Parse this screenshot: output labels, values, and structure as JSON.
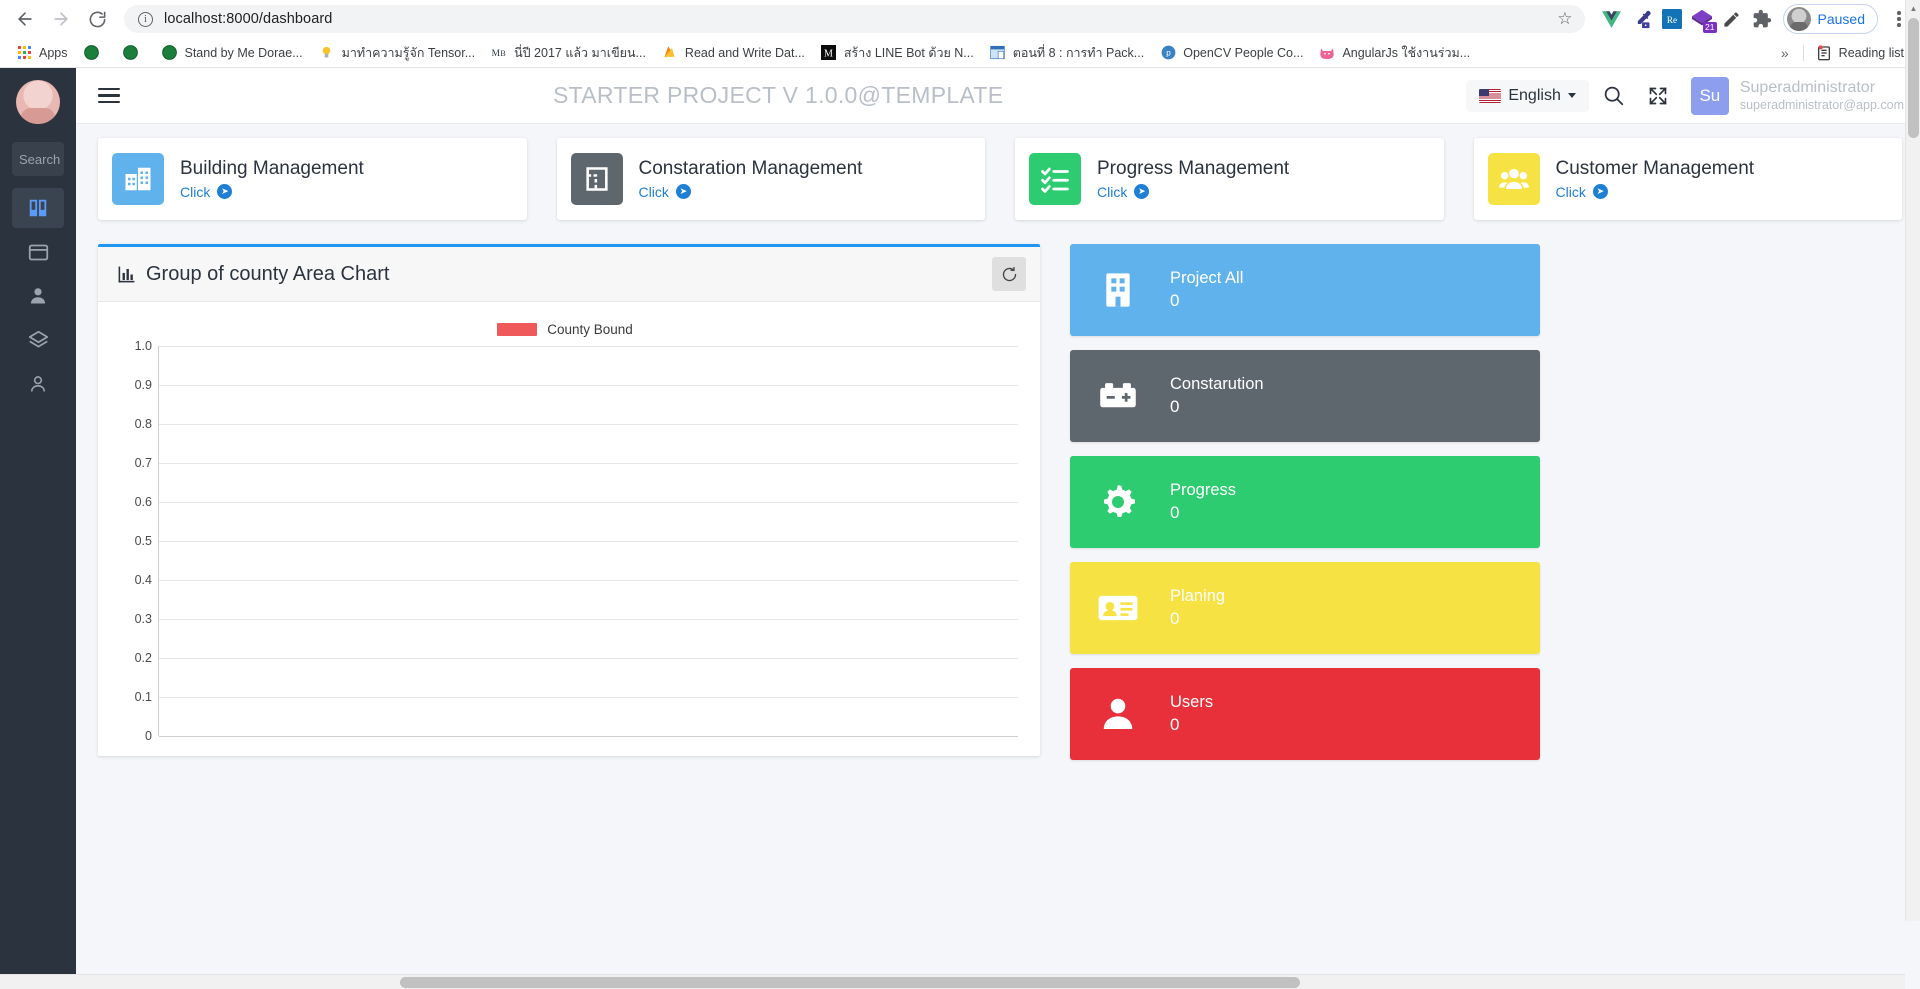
{
  "browser": {
    "back_label": "Back",
    "forward_label": "Forward",
    "reload_label": "Reload",
    "url": "localhost:8000/dashboard",
    "bookmark_star": "star-outline",
    "extensions": [
      {
        "name": "vue-devtools-icon",
        "label": "V"
      },
      {
        "name": "eyedropper-icon",
        "label": ""
      },
      {
        "name": "redux-devtools-icon",
        "label": "Re"
      },
      {
        "name": "badge-extension-icon",
        "label": "21"
      },
      {
        "name": "pencil-extension-icon",
        "label": ""
      },
      {
        "name": "puzzle-extensions-icon",
        "label": ""
      }
    ],
    "profile": {
      "label": "Paused"
    },
    "bookmarks": [
      {
        "label": "Apps",
        "icon": "apps-grid-icon"
      },
      {
        "label": "",
        "icon": "globe-icon"
      },
      {
        "label": "",
        "icon": "globe-icon"
      },
      {
        "label": "Stand by Me Dorae...",
        "icon": "globe-icon"
      },
      {
        "label": "มาทำความรู้จัก Tensor...",
        "icon": "bulb-icon"
      },
      {
        "label": "นี่ปี 2017 แล้ว มาเขียน...",
        "icon": "medium-icon"
      },
      {
        "label": "Read and Write Dat...",
        "icon": "firebase-icon"
      },
      {
        "label": "สร้าง LINE Bot ด้วย N...",
        "icon": "medium-square-icon"
      },
      {
        "label": "ตอนที่ 8 : การทำ Pack...",
        "icon": "window-icon"
      },
      {
        "label": "OpenCV People Co...",
        "icon": "python-icon"
      },
      {
        "label": "AngularJs ใช้งานร่วม...",
        "icon": "cat-icon"
      }
    ],
    "overflow_label": "»",
    "reading_list": "Reading list"
  },
  "sidebar": {
    "avatar": "user-avatar",
    "search_placeholder": "Search",
    "items": [
      {
        "name": "sidebar-item-dashboard",
        "icon": "book-icon",
        "active": true
      },
      {
        "name": "sidebar-item-window",
        "icon": "window-icon",
        "active": false
      },
      {
        "name": "sidebar-item-user",
        "icon": "person-icon",
        "active": false
      },
      {
        "name": "sidebar-item-layers",
        "icon": "layers-icon",
        "active": false
      },
      {
        "name": "sidebar-item-account",
        "icon": "person-outline-icon",
        "active": false
      }
    ]
  },
  "topbar": {
    "menu_icon": "hamburger-icon",
    "title": "STARTER PROJECT V 1.0.0@TEMPLATE",
    "language": "English",
    "search_icon": "search-icon",
    "fullscreen_icon": "expand-icon",
    "user": {
      "initials": "Su",
      "name": "Superadministrator",
      "email": "superadministrator@app.com"
    }
  },
  "quick_cards": [
    {
      "title": "Building Management",
      "link": "Click",
      "icon": "building-icon",
      "color": "#60b2ec"
    },
    {
      "title": "Constaration Management",
      "link": "Click",
      "icon": "blueprint-icon",
      "color": "#5e666e"
    },
    {
      "title": "Progress Management",
      "link": "Click",
      "icon": "checklist-icon",
      "color": "#2ecc71"
    },
    {
      "title": "Customer Management",
      "link": "Click",
      "icon": "people-icon",
      "color": "#f7e244"
    }
  ],
  "chart_panel": {
    "title": "Group of county Area Chart",
    "title_icon": "bar-chart-icon",
    "refresh_icon": "refresh-icon"
  },
  "chart_data": {
    "type": "area",
    "title": "Group of county Area Chart",
    "xlabel": "",
    "ylabel": "",
    "legend": [
      "County Bound"
    ],
    "legend_position": "top-center",
    "legend_colors": [
      "#f0595a"
    ],
    "grid": true,
    "ylim": [
      0,
      1.0
    ],
    "yticks": [
      "1.0",
      "0.9",
      "0.8",
      "0.7",
      "0.6",
      "0.5",
      "0.4",
      "0.3",
      "0.2",
      "0.1",
      "0"
    ],
    "categories": [],
    "series": [
      {
        "name": "County Bound",
        "values": [],
        "color": "#f0595a"
      }
    ]
  },
  "stats": [
    {
      "label": "Project All",
      "value": "0",
      "color": "#60b2ec",
      "icon": "building-icon"
    },
    {
      "label": "Constarution",
      "value": "0",
      "color": "#5e666e",
      "icon": "battery-icon"
    },
    {
      "label": "Progress",
      "value": "0",
      "color": "#2ecc71",
      "icon": "gear-icon"
    },
    {
      "label": "Planing",
      "value": "0",
      "color": "#f7e244",
      "icon": "id-card-icon"
    },
    {
      "label": "Users",
      "value": "0",
      "color": "#e8303a",
      "icon": "person-icon"
    }
  ]
}
